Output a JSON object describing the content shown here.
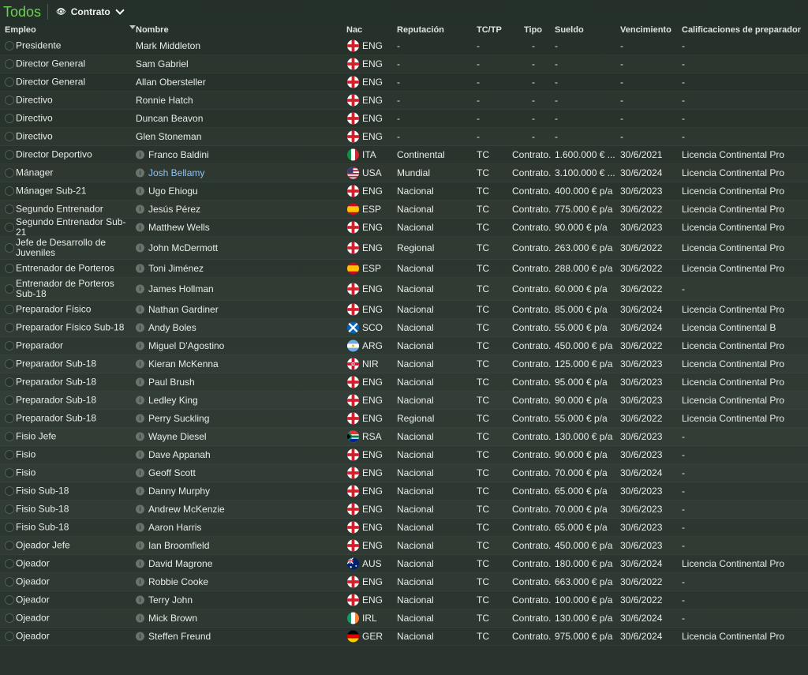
{
  "top": {
    "title": "Todos",
    "view_label": "Contrato"
  },
  "columns": {
    "empleo": "Empleo",
    "nombre": "Nombre",
    "nac": "Nac",
    "reputacion": "Reputación",
    "tctp": "TC/TP",
    "tipo": "Tipo",
    "sueldo": "Sueldo",
    "vencimiento": "Vencimiento",
    "calificaciones": "Calificaciones de preparador"
  },
  "rows": [
    {
      "job": "Presidente",
      "name": "Mark Middleton",
      "info": false,
      "flag": "ENG",
      "nat": "ENG",
      "rep": "-",
      "tctp": "-",
      "tipo": "-",
      "sueldo": "-",
      "venc": "-",
      "calif": "-"
    },
    {
      "job": "Director General",
      "name": "Sam Gabriel",
      "info": false,
      "flag": "ENG",
      "nat": "ENG",
      "rep": "-",
      "tctp": "-",
      "tipo": "-",
      "sueldo": "-",
      "venc": "-",
      "calif": "-"
    },
    {
      "job": "Director General",
      "name": "Allan Obersteller",
      "info": false,
      "flag": "ENG",
      "nat": "ENG",
      "rep": "-",
      "tctp": "-",
      "tipo": "-",
      "sueldo": "-",
      "venc": "-",
      "calif": "-"
    },
    {
      "job": "Directivo",
      "name": "Ronnie Hatch",
      "info": false,
      "flag": "ENG",
      "nat": "ENG",
      "rep": "-",
      "tctp": "-",
      "tipo": "-",
      "sueldo": "-",
      "venc": "-",
      "calif": "-"
    },
    {
      "job": "Directivo",
      "name": "Duncan Beavon",
      "info": false,
      "flag": "ENG",
      "nat": "ENG",
      "rep": "-",
      "tctp": "-",
      "tipo": "-",
      "sueldo": "-",
      "venc": "-",
      "calif": "-"
    },
    {
      "job": "Directivo",
      "name": "Glen Stoneman",
      "info": false,
      "flag": "ENG",
      "nat": "ENG",
      "rep": "-",
      "tctp": "-",
      "tipo": "-",
      "sueldo": "-",
      "venc": "-",
      "calif": "-"
    },
    {
      "job": "Director Deportivo",
      "name": "Franco Baldini",
      "info": true,
      "flag": "ITA",
      "nat": "ITA",
      "rep": "Continental",
      "tctp": "TC",
      "tipo": "Contrato...",
      "sueldo": "1.600.000 € ...",
      "venc": "30/6/2021",
      "calif": "Licencia Continental Pro"
    },
    {
      "job": "Mánager",
      "name": "Josh Bellamy",
      "info": true,
      "link": true,
      "flag": "USA",
      "nat": "USA",
      "rep": "Mundial",
      "tctp": "TC",
      "tipo": "Contrato...",
      "sueldo": "3.100.000 € ...",
      "venc": "30/6/2024",
      "calif": "Licencia Continental Pro"
    },
    {
      "job": "Mánager Sub-21",
      "name": "Ugo Ehiogu",
      "info": true,
      "flag": "ENG",
      "nat": "ENG",
      "rep": "Nacional",
      "tctp": "TC",
      "tipo": "Contrato...",
      "sueldo": "400.000 € p/a",
      "venc": "30/6/2023",
      "calif": "Licencia Continental Pro"
    },
    {
      "job": "Segundo Entrenador",
      "name": "Jesús Pérez",
      "info": true,
      "flag": "ESP",
      "nat": "ESP",
      "rep": "Nacional",
      "tctp": "TC",
      "tipo": "Contrato...",
      "sueldo": "775.000 € p/a",
      "venc": "30/6/2022",
      "calif": "Licencia Continental Pro"
    },
    {
      "job": "Segundo Entrenador Sub-21",
      "name": "Matthew Wells",
      "info": true,
      "flag": "ENG",
      "nat": "ENG",
      "rep": "Nacional",
      "tctp": "TC",
      "tipo": "Contrato...",
      "sueldo": "90.000 € p/a",
      "venc": "30/6/2023",
      "calif": "Licencia Continental Pro"
    },
    {
      "job": "Jefe de Desarrollo de Juveniles",
      "name": "John McDermott",
      "info": true,
      "tall": true,
      "flag": "ENG",
      "nat": "ENG",
      "rep": "Regional",
      "tctp": "TC",
      "tipo": "Contrato...",
      "sueldo": "263.000 € p/a",
      "venc": "30/6/2022",
      "calif": "Licencia Continental Pro"
    },
    {
      "job": "Entrenador de Porteros",
      "name": "Toni Jiménez",
      "info": true,
      "flag": "ESP",
      "nat": "ESP",
      "rep": "Nacional",
      "tctp": "TC",
      "tipo": "Contrato...",
      "sueldo": "288.000 € p/a",
      "venc": "30/6/2022",
      "calif": "Licencia Continental Pro"
    },
    {
      "job": "Entrenador de Porteros Sub-18",
      "name": "James Hollman",
      "info": true,
      "tall": true,
      "flag": "ENG",
      "nat": "ENG",
      "rep": "Nacional",
      "tctp": "TC",
      "tipo": "Contrato...",
      "sueldo": "60.000 € p/a",
      "venc": "30/6/2022",
      "calif": "-"
    },
    {
      "job": "Preparador Físico",
      "name": "Nathan Gardiner",
      "info": true,
      "flag": "ENG",
      "nat": "ENG",
      "rep": "Nacional",
      "tctp": "TC",
      "tipo": "Contrato...",
      "sueldo": "85.000 € p/a",
      "venc": "30/6/2024",
      "calif": "Licencia Continental Pro"
    },
    {
      "job": "Preparador Físico Sub-18",
      "name": "Andy Boles",
      "info": true,
      "flag": "SCO",
      "nat": "SCO",
      "rep": "Nacional",
      "tctp": "TC",
      "tipo": "Contrato...",
      "sueldo": "55.000 € p/a",
      "venc": "30/6/2024",
      "calif": "Licencia Continental B"
    },
    {
      "job": "Preparador",
      "name": "Miguel D'Agostino",
      "info": true,
      "flag": "ARG",
      "nat": "ARG",
      "rep": "Nacional",
      "tctp": "TC",
      "tipo": "Contrato...",
      "sueldo": "450.000 € p/a",
      "venc": "30/6/2022",
      "calif": "Licencia Continental Pro"
    },
    {
      "job": "Preparador Sub-18",
      "name": "Kieran McKenna",
      "info": true,
      "flag": "NIR",
      "nat": "NIR",
      "rep": "Nacional",
      "tctp": "TC",
      "tipo": "Contrato...",
      "sueldo": "125.000 € p/a",
      "venc": "30/6/2023",
      "calif": "Licencia Continental Pro"
    },
    {
      "job": "Preparador Sub-18",
      "name": "Paul Brush",
      "info": true,
      "flag": "ENG",
      "nat": "ENG",
      "rep": "Nacional",
      "tctp": "TC",
      "tipo": "Contrato...",
      "sueldo": "95.000 € p/a",
      "venc": "30/6/2023",
      "calif": "Licencia Continental Pro"
    },
    {
      "job": "Preparador Sub-18",
      "name": "Ledley King",
      "info": true,
      "flag": "ENG",
      "nat": "ENG",
      "rep": "Nacional",
      "tctp": "TC",
      "tipo": "Contrato...",
      "sueldo": "90.000 € p/a",
      "venc": "30/6/2023",
      "calif": "Licencia Continental Pro"
    },
    {
      "job": "Preparador Sub-18",
      "name": "Perry Suckling",
      "info": true,
      "flag": "ENG",
      "nat": "ENG",
      "rep": "Regional",
      "tctp": "TC",
      "tipo": "Contrato...",
      "sueldo": "55.000 € p/a",
      "venc": "30/6/2022",
      "calif": "Licencia Continental Pro"
    },
    {
      "job": "Fisio Jefe",
      "name": "Wayne Diesel",
      "info": true,
      "flag": "RSA",
      "nat": "RSA",
      "rep": "Nacional",
      "tctp": "TC",
      "tipo": "Contrato...",
      "sueldo": "130.000 € p/a",
      "venc": "30/6/2023",
      "calif": "-"
    },
    {
      "job": "Fisio",
      "name": "Dave Appanah",
      "info": true,
      "flag": "ENG",
      "nat": "ENG",
      "rep": "Nacional",
      "tctp": "TC",
      "tipo": "Contrato...",
      "sueldo": "90.000 € p/a",
      "venc": "30/6/2023",
      "calif": "-"
    },
    {
      "job": "Fisio",
      "name": "Geoff Scott",
      "info": true,
      "flag": "ENG",
      "nat": "ENG",
      "rep": "Nacional",
      "tctp": "TC",
      "tipo": "Contrato...",
      "sueldo": "70.000 € p/a",
      "venc": "30/6/2024",
      "calif": "-"
    },
    {
      "job": "Fisio Sub-18",
      "name": "Danny Murphy",
      "info": true,
      "flag": "ENG",
      "nat": "ENG",
      "rep": "Nacional",
      "tctp": "TC",
      "tipo": "Contrato...",
      "sueldo": "65.000 € p/a",
      "venc": "30/6/2023",
      "calif": "-"
    },
    {
      "job": "Fisio Sub-18",
      "name": "Andrew McKenzie",
      "info": true,
      "flag": "ENG",
      "nat": "ENG",
      "rep": "Nacional",
      "tctp": "TC",
      "tipo": "Contrato...",
      "sueldo": "70.000 € p/a",
      "venc": "30/6/2023",
      "calif": "-"
    },
    {
      "job": "Fisio Sub-18",
      "name": "Aaron Harris",
      "info": true,
      "flag": "ENG",
      "nat": "ENG",
      "rep": "Nacional",
      "tctp": "TC",
      "tipo": "Contrato...",
      "sueldo": "65.000 € p/a",
      "venc": "30/6/2023",
      "calif": "-"
    },
    {
      "job": "Ojeador Jefe",
      "name": "Ian Broomfield",
      "info": true,
      "flag": "ENG",
      "nat": "ENG",
      "rep": "Nacional",
      "tctp": "TC",
      "tipo": "Contrato...",
      "sueldo": "450.000 € p/a",
      "venc": "30/6/2023",
      "calif": "-"
    },
    {
      "job": "Ojeador",
      "name": "David Magrone",
      "info": true,
      "flag": "AUS",
      "nat": "AUS",
      "rep": "Nacional",
      "tctp": "TC",
      "tipo": "Contrato...",
      "sueldo": "180.000 € p/a",
      "venc": "30/6/2024",
      "calif": "Licencia Continental Pro"
    },
    {
      "job": "Ojeador",
      "name": "Robbie Cooke",
      "info": true,
      "flag": "ENG",
      "nat": "ENG",
      "rep": "Nacional",
      "tctp": "TC",
      "tipo": "Contrato...",
      "sueldo": "663.000 € p/a",
      "venc": "30/6/2022",
      "calif": "-"
    },
    {
      "job": "Ojeador",
      "name": "Terry John",
      "info": true,
      "flag": "ENG",
      "nat": "ENG",
      "rep": "Nacional",
      "tctp": "TC",
      "tipo": "Contrato...",
      "sueldo": "100.000 € p/a",
      "venc": "30/6/2022",
      "calif": "-"
    },
    {
      "job": "Ojeador",
      "name": "Mick Brown",
      "info": true,
      "flag": "IRL",
      "nat": "IRL",
      "rep": "Nacional",
      "tctp": "TC",
      "tipo": "Contrato...",
      "sueldo": "130.000 € p/a",
      "venc": "30/6/2024",
      "calif": "-"
    },
    {
      "job": "Ojeador",
      "name": "Steffen Freund",
      "info": true,
      "flag": "GER",
      "nat": "GER",
      "rep": "Nacional",
      "tctp": "TC",
      "tipo": "Contrato...",
      "sueldo": "975.000 € p/a",
      "venc": "30/6/2024",
      "calif": "Licencia Continental Pro"
    }
  ]
}
